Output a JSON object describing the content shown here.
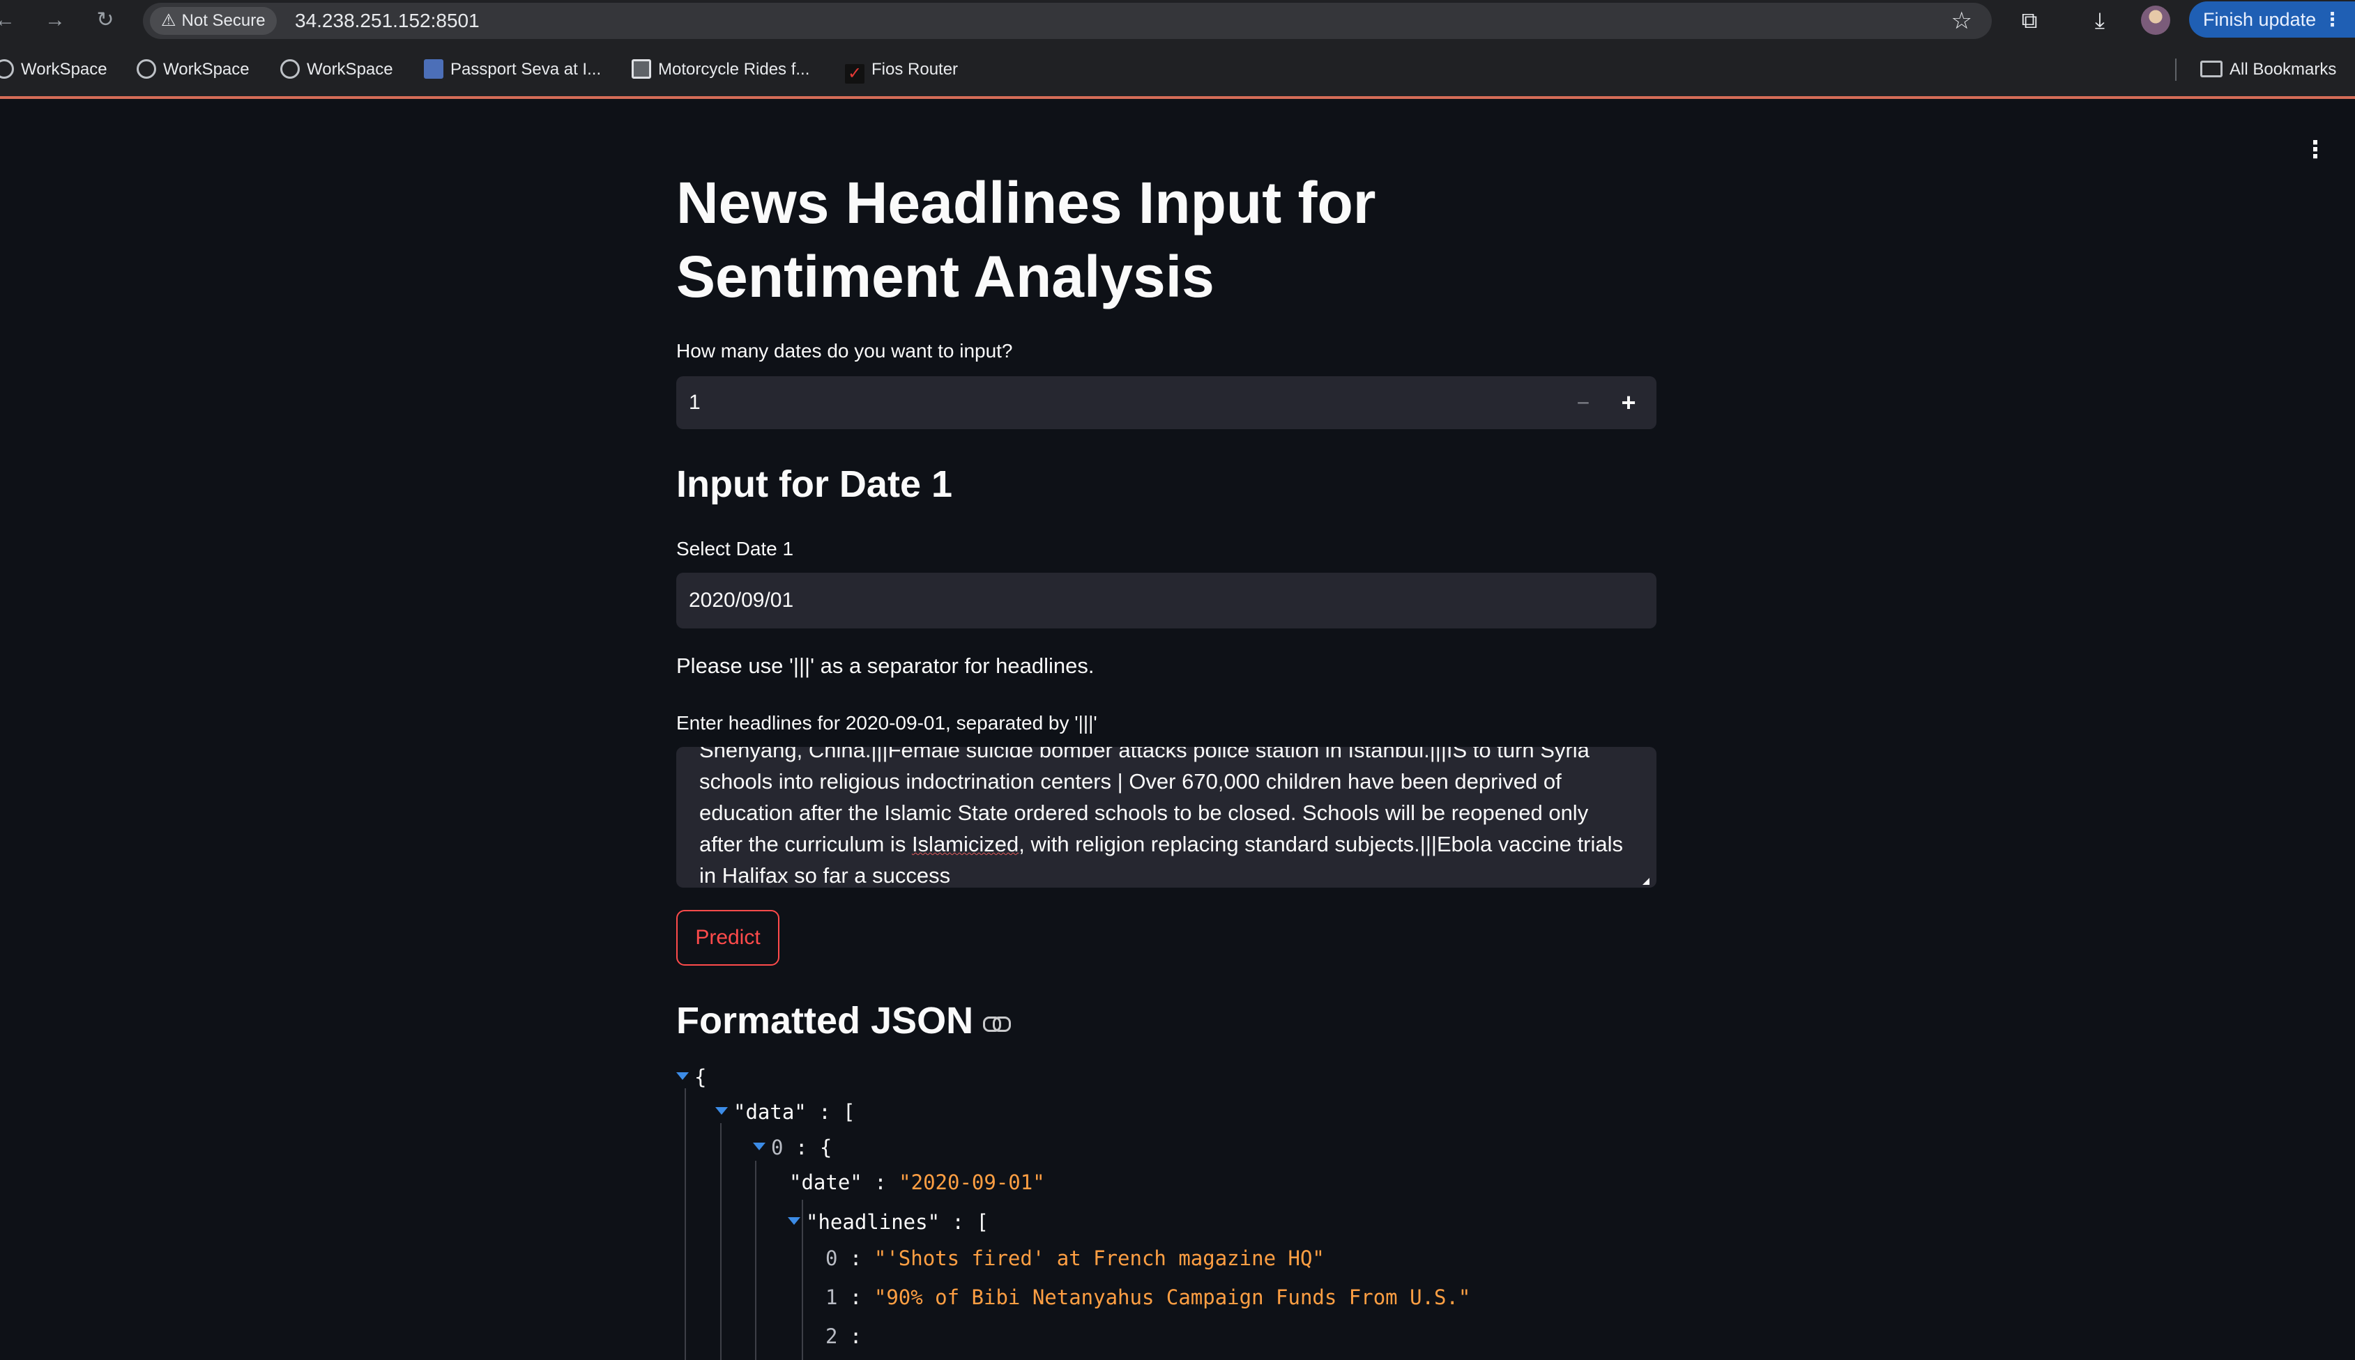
{
  "browser": {
    "security_label": "Not Secure",
    "url": "34.238.251.152:8501",
    "update_label": "Finish update",
    "bookmarks": [
      {
        "label": "WorkSpace",
        "icon": "workspace-icon"
      },
      {
        "label": "WorkSpace",
        "icon": "globe-icon"
      },
      {
        "label": "WorkSpace",
        "icon": "workspace-icon"
      },
      {
        "label": "Passport Seva at I...",
        "icon": "passport-seva-icon"
      },
      {
        "label": "Motorcycle Rides f...",
        "icon": "calendar-icon"
      },
      {
        "label": "Fios Router",
        "icon": "checkmark-icon"
      }
    ],
    "all_bookmarks_label": "All Bookmarks"
  },
  "app": {
    "title": "News Headlines Input for Sentiment Analysis",
    "num_dates": {
      "label": "How many dates do you want to input?",
      "value": "1"
    },
    "date_section": {
      "heading": "Input for Date 1",
      "date_label": "Select Date 1",
      "date_value": "2020/09/01"
    },
    "separator_note": "Please use '|||' as a separator for headlines.",
    "headlines": {
      "label": "Enter headlines for 2020-09-01, separated by '|||'",
      "text_before": "Shenyang, China.|||Female suicide bomber attacks police station in Istanbul.|||IS to turn Syria schools into religious indoctrination centers | Over 670,000 children have been deprived of education after the Islamic State ordered schools to be closed. Schools will be reopened only after the curriculum is ",
      "text_flagged": "Islamicized",
      "text_after": ", with religion replacing standard subjects.|||Ebola vaccine trials in Halifax so far a success"
    },
    "predict_label": "Predict",
    "json_heading": "Formatted JSON",
    "json_view": {
      "open_brace": "{",
      "data_key": "\"data\"",
      "data_open": ": [",
      "item0_idx": "0",
      "item0_open": ": {",
      "date_key": "\"date\"",
      "date_val": "\"2020-09-01\"",
      "headlines_key": "\"headlines\"",
      "headlines_open": ": [",
      "h0_idx": "0",
      "h0_val": "\"'Shots fired' at French magazine HQ\"",
      "h1_idx": "1",
      "h1_val": "\"90% of Bibi Netanyahus Campaign Funds From U.S.\"",
      "h2_idx": "2"
    }
  }
}
